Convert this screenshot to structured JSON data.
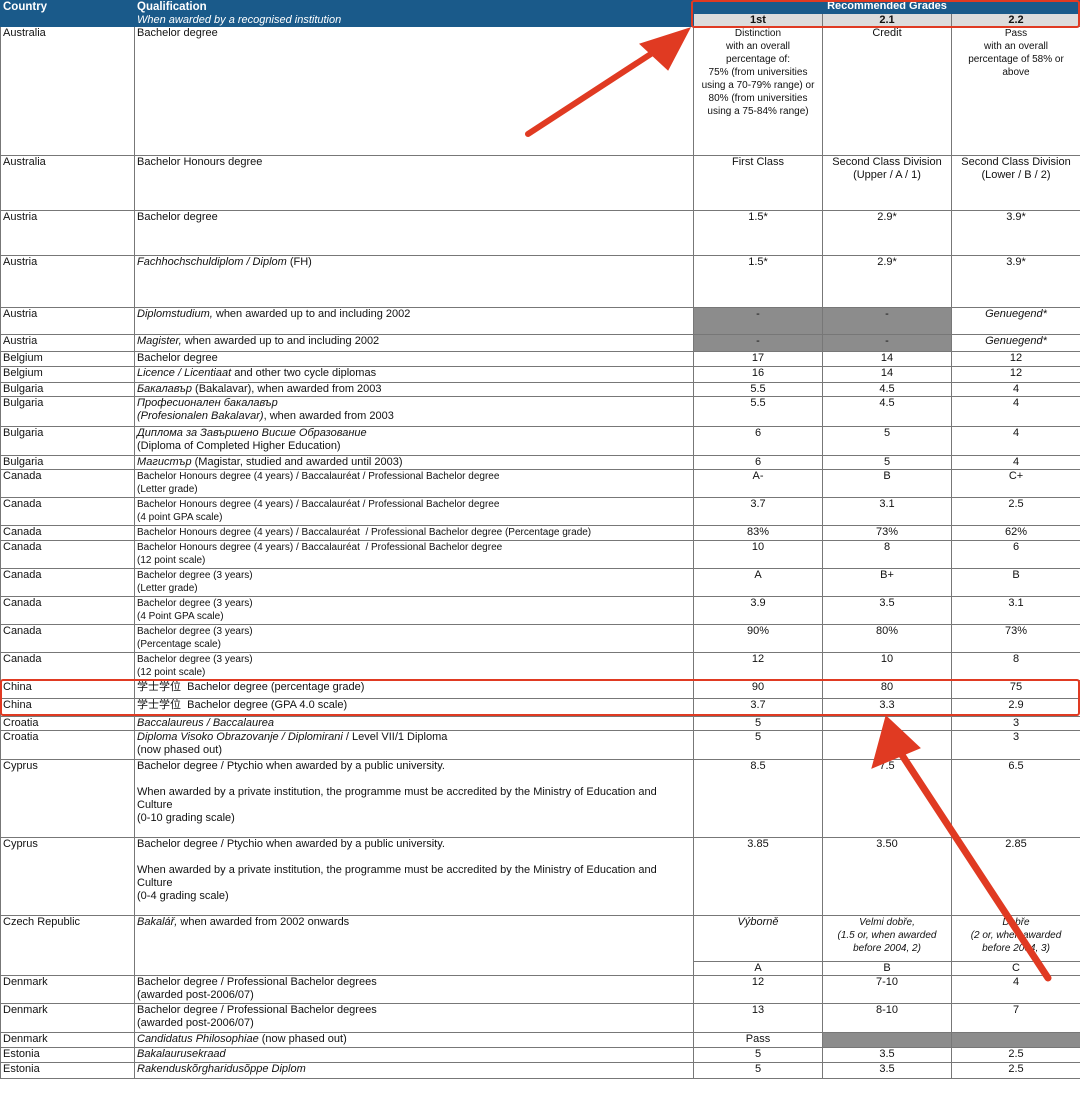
{
  "header": {
    "country": "Country",
    "qualification": "Qualification",
    "qualification_sub": "When awarded by a recognised institution",
    "recommended": "Recommended Grades",
    "g1": "1st",
    "g2": "2.1",
    "g3": "2.2"
  },
  "rows": [
    {
      "country": "Australia",
      "q": "Bachelor degree",
      "g1": "Distinction\nwith an overall\npercentage of:\n75% (from universities\nusing a 70-79% range) or\n80% (from universities\nusing a 75-84% range)",
      "g2": "Credit",
      "g3": "Pass\nwith an overall\npercentage of 58% or\nabove"
    },
    {
      "country": "Australia",
      "q": "Bachelor Honours degree",
      "g1": "First Class",
      "g2": "Second Class Division\n(Upper / A / 1)",
      "g3": "Second Class Division\n(Lower / B / 2)"
    },
    {
      "country": "Austria",
      "q": "Bachelor degree",
      "g1": "1.5*",
      "g2": "2.9*",
      "g3": "3.9*"
    },
    {
      "country": "Austria",
      "q_it": "Fachhochschuldiplom / Diplom",
      "q_rest": " (FH)",
      "g1": "1.5*",
      "g2": "2.9*",
      "g3": "3.9*"
    },
    {
      "country": "Austria",
      "q_it": "Diplomstudium,",
      "q_rest": " when awarded up to and including 2002",
      "g1": "-",
      "g2": "-",
      "g3": "Genuegend*"
    },
    {
      "country": "Austria",
      "q_it": "Magister,",
      "q_rest": " when awarded up to and including 2002",
      "g1": "-",
      "g2": "-",
      "g3": "Genuegend*"
    },
    {
      "country": "Belgium",
      "q": "Bachelor degree",
      "g1": "17",
      "g2": "14",
      "g3": "12"
    },
    {
      "country": "Belgium",
      "q_it": "Licence / Licentiaat",
      "q_rest": " and other two cycle diplomas",
      "g1": "16",
      "g2": "14",
      "g3": "12"
    },
    {
      "country": "Bulgaria",
      "q_it": "Бакалавър",
      "q_rest": " (Bakalavar), when awarded from 2003",
      "g1": "5.5",
      "g2": "4.5",
      "g3": "4"
    },
    {
      "country": "Bulgaria",
      "q_it": "Професионален бакалавър",
      "q_line2_it": "(Profesionalen Bakalavar)",
      "q_line2_rest": ", when awarded from 2003",
      "g1": "5.5",
      "g2": "4.5",
      "g3": "4"
    },
    {
      "country": "Bulgaria",
      "q_it": "Диплома за Завършено Висше Образование",
      "q_line2_rest": "(Diploma of Completed Higher Education)",
      "g1": "6",
      "g2": "5",
      "g3": "4"
    },
    {
      "country": "Bulgaria",
      "q_it": "Магистър",
      "q_rest": " (Magistar, studied and awarded until 2003)",
      "g1": "6",
      "g2": "5",
      "g3": "4"
    },
    {
      "country": "Canada",
      "q": "Bachelor Honours degree (4 years) / Baccalauréat / Professional Bachelor degree\n(Letter grade)",
      "g1": "A-",
      "g2": "B",
      "g3": "C+"
    },
    {
      "country": "Canada",
      "q": "Bachelor Honours degree (4 years) / Baccalauréat / Professional Bachelor degree\n(4 point GPA scale)",
      "g1": "3.7",
      "g2": "3.1",
      "g3": "2.5"
    },
    {
      "country": "Canada",
      "q": "Bachelor Honours degree (4 years) / Baccalauréat  / Professional Bachelor degree (Percentage grade)",
      "g1": "83%",
      "g2": "73%",
      "g3": "62%"
    },
    {
      "country": "Canada",
      "q": "Bachelor Honours degree (4 years) / Baccalauréat  / Professional Bachelor degree\n(12 point scale)",
      "g1": "10",
      "g2": "8",
      "g3": "6"
    },
    {
      "country": "Canada",
      "q": "Bachelor degree (3 years)\n(Letter grade)",
      "g1": "A",
      "g2": "B+",
      "g3": "B"
    },
    {
      "country": "Canada",
      "q": "Bachelor degree (3 years)\n(4 Point GPA scale)",
      "g1": "3.9",
      "g2": "3.5",
      "g3": "3.1"
    },
    {
      "country": "Canada",
      "q": "Bachelor degree (3 years)\n(Percentage scale)",
      "g1": "90%",
      "g2": "80%",
      "g3": "73%"
    },
    {
      "country": "Canada",
      "q": "Bachelor degree (3 years)\n(12 point scale)",
      "g1": "12",
      "g2": "10",
      "g3": "8"
    },
    {
      "country": "China",
      "q": "学士学位  Bachelor degree (percentage grade)",
      "g1": "90",
      "g2": "80",
      "g3": "75"
    },
    {
      "country": "China",
      "q": "学士学位  Bachelor degree (GPA 4.0 scale)",
      "g1": "3.7",
      "g2": "3.3",
      "g3": "2.9"
    },
    {
      "country": "Croatia",
      "q_it": "Baccalaureus / Baccalaurea",
      "g1": "5",
      "g2": "4",
      "g3": "3"
    },
    {
      "country": "Croatia",
      "q_it": "Diploma Visoko Obrazovanje / Diplomirani",
      "q_rest": " / Level VII/1 Diploma",
      "q_line2_rest": "(now phased out)",
      "g1": "5",
      "g2": "4",
      "g3": "3"
    },
    {
      "country": "Cyprus",
      "q": "Bachelor degree / Ptychio when awarded by a public university.\n\nWhen awarded by a private institution, the programme must be accredited by the Ministry of Education and Culture\n(0-10 grading scale)",
      "g1": "8.5",
      "g2": "7.5",
      "g3": "6.5"
    },
    {
      "country": "Cyprus",
      "q": "Bachelor degree / Ptychio when awarded by a public university.\n\nWhen awarded by a private institution, the programme must be accredited by the Ministry of Education and Culture\n(0-4 grading scale)",
      "g1": "3.85",
      "g2": "3.50",
      "g3": "2.85"
    },
    {
      "country": "Czech Republic",
      "q_it": "Bakalář,",
      "q_rest": " when awarded from 2002 onwards",
      "g1": "Výborně",
      "g2": "Velmi dobře,\n(1.5 or, when awarded\nbefore 2004, 2)",
      "g3": "Dobře\n(2 or, when awarded\nbefore 2004, 3)",
      "g1b": "A",
      "g2b": "B",
      "g3b": "C"
    },
    {
      "country": "Denmark",
      "q": "Bachelor degree / Professional Bachelor degrees\n(awarded post-2006/07)",
      "g1": "12",
      "g2": "7-10",
      "g3": "4"
    },
    {
      "country": "Denmark",
      "q": "Bachelor degree / Professional Bachelor degrees\n(awarded post-2006/07)",
      "g1": "13",
      "g2": "8-10",
      "g3": "7"
    },
    {
      "country": "Denmark",
      "q_it": "Candidatus Philosophiae",
      "q_rest": " (now phased out)",
      "g1": "Pass",
      "g2": "",
      "g3": ""
    },
    {
      "country": "Estonia",
      "q_it": "Bakalaurusekraad",
      "g1": "5",
      "g2": "3.5",
      "g3": "2.5"
    },
    {
      "country": "Estonia",
      "q_it": "Rakenduskõrgharidusõppe Diplom",
      "g1": "5",
      "g2": "3.5",
      "g3": "2.5"
    }
  ]
}
